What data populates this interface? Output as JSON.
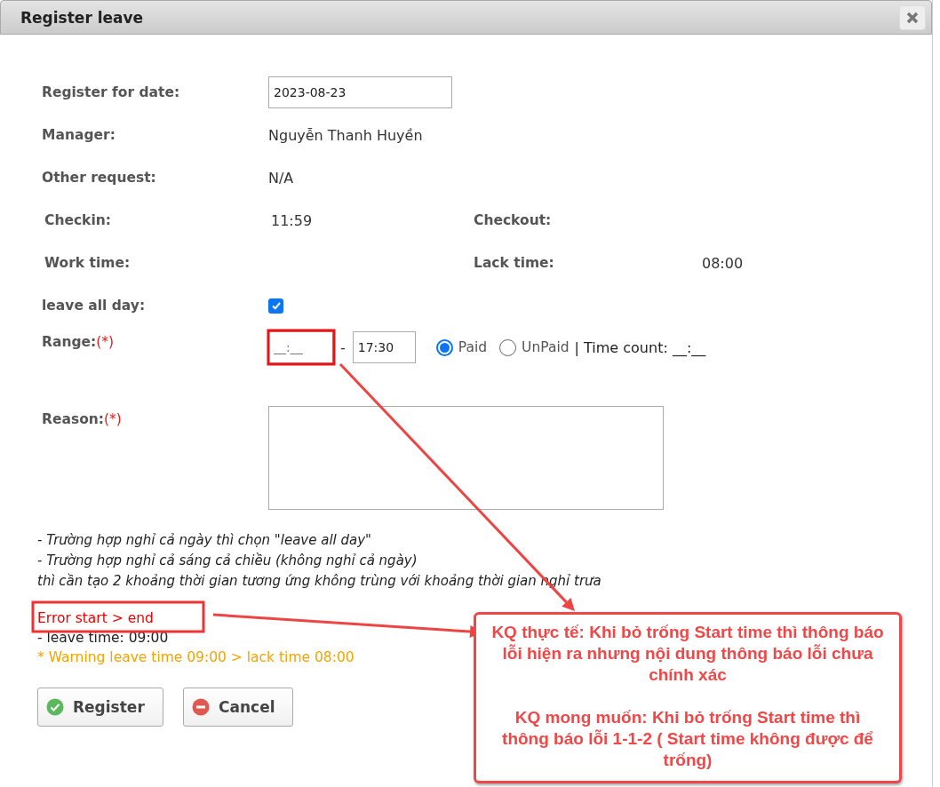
{
  "dialog": {
    "title": "Register leave"
  },
  "fields": [
    {
      "kind": "input",
      "label": "Register for date:",
      "value": "2023-08-23"
    },
    {
      "kind": "text",
      "label": "Manager:",
      "value": "Nguyễn Thanh Huyền"
    },
    {
      "kind": "text",
      "label": "Other request:",
      "value": "N/A"
    }
  ],
  "times": [
    [
      {
        "label": "Checkin:",
        "value": "11:59"
      },
      {
        "label": "Checkout:"
      }
    ],
    [
      {
        "label": "Work time:"
      },
      {
        "label": "Lack time:",
        "value": "08:00"
      }
    ]
  ],
  "leave_all_day": {
    "label": "leave all day:",
    "checked": true
  },
  "range": {
    "label": "Range:",
    "required": "(*)",
    "start": {
      "placeholder": "__:__"
    },
    "separator": "-",
    "end": {
      "value": "17:30"
    },
    "pay_types": [
      {
        "label": "Paid",
        "selected": true
      },
      {
        "label": "UnPaid",
        "selected": false
      }
    ],
    "time_count": "| Time count: __:__"
  },
  "reason": {
    "label": "Reason:",
    "required": "(*)"
  },
  "notes": [
    "- Trường hợp nghỉ cả ngày thì chọn \"leave all day\"",
    "- Trường hợp nghỉ cả sáng cả chiều (không nghỉ cả ngày)",
    "thì cần tạo 2 khoảng thời gian tương ứng không trùng với khoảng thời gian nghỉ trưa"
  ],
  "messages": [
    {
      "kind": "error",
      "text": "Error start > end"
    },
    {
      "kind": "info",
      "text": "- leave time: 09:00"
    },
    {
      "kind": "warning",
      "text": "* Warning leave time 09:00 > lack time 08:00"
    }
  ],
  "buttons": [
    {
      "kind": "register",
      "label": "Register"
    },
    {
      "kind": "cancel",
      "label": "Cancel"
    }
  ],
  "annotation": {
    "paragraphs": [
      "KQ thực tế: Khi bỏ trống Start time thì thông báo lỗi hiện ra nhưng nội dung thông báo lỗi chưa chính xác",
      "KQ mong muốn: Khi bỏ trống Start time thì thông báo lỗi  1-1-2 ( Start time không được để trống)"
    ]
  }
}
